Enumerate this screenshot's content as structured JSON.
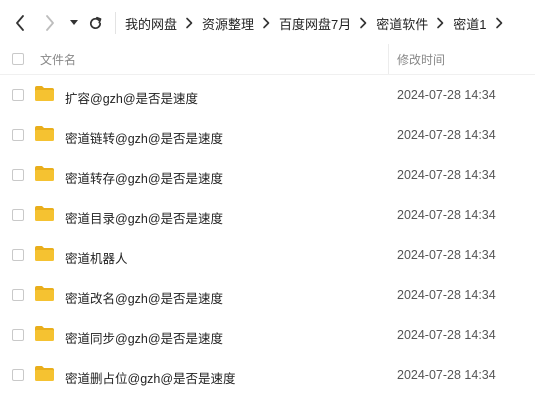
{
  "breadcrumb": [
    "我的网盘",
    "资源整理",
    "百度网盘7月",
    "密道软件",
    "密道1"
  ],
  "header": {
    "name_label": "文件名",
    "date_label": "修改时间"
  },
  "files": [
    {
      "name": "扩容@gzh@是否是速度",
      "date": "2024-07-28 14:34"
    },
    {
      "name": "密道链转@gzh@是否是速度",
      "date": "2024-07-28 14:34"
    },
    {
      "name": "密道转存@gzh@是否是速度",
      "date": "2024-07-28 14:34"
    },
    {
      "name": "密道目录@gzh@是否是速度",
      "date": "2024-07-28 14:34"
    },
    {
      "name": "密道机器人",
      "date": "2024-07-28 14:34"
    },
    {
      "name": "密道改名@gzh@是否是速度",
      "date": "2024-07-28 14:34"
    },
    {
      "name": "密道同步@gzh@是否是速度",
      "date": "2024-07-28 14:34"
    },
    {
      "name": "密道删占位@gzh@是否是速度",
      "date": "2024-07-28 14:34"
    }
  ],
  "colors": {
    "folder": "#F5C231",
    "folder_tab": "#E9AE1B"
  }
}
